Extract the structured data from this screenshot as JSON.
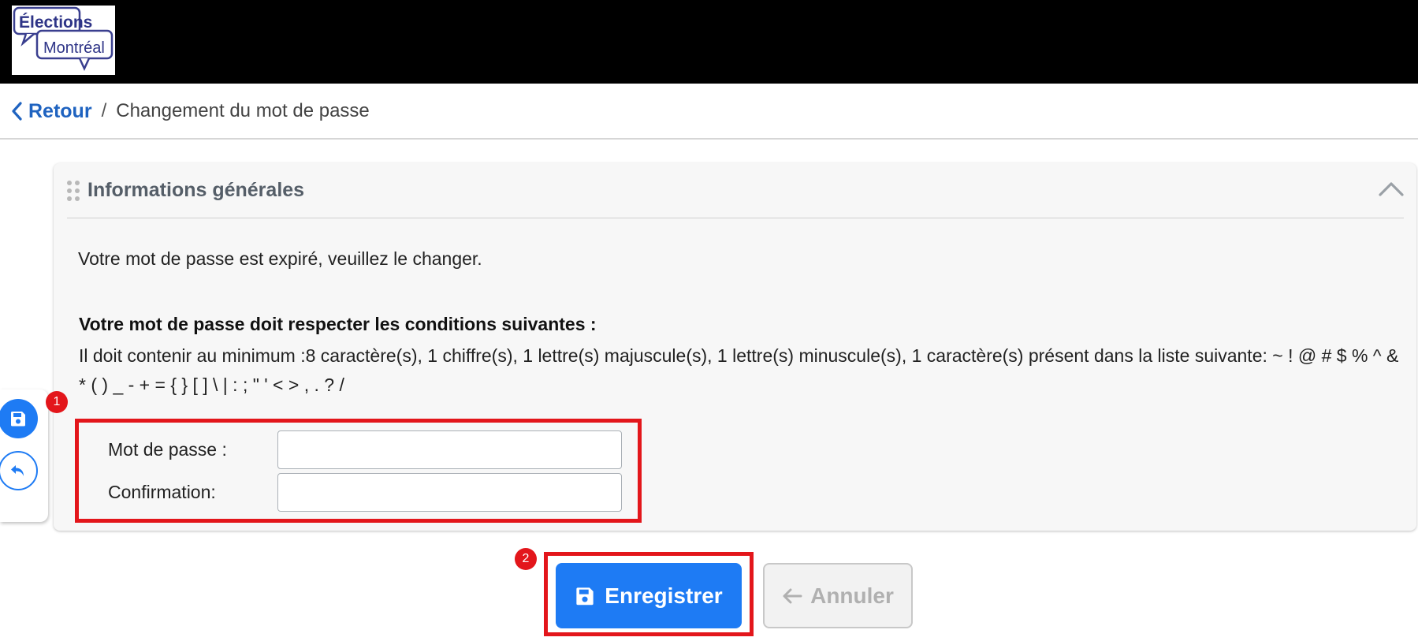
{
  "header": {
    "logo_line1": "Élections",
    "logo_line2": "Montréal"
  },
  "breadcrumb": {
    "back_label": "Retour",
    "separator": "/",
    "current": "Changement du mot de passe"
  },
  "side_tools": {
    "save_icon": "floppy-disk-icon",
    "undo_icon": "undo-arrow-icon"
  },
  "panel": {
    "title": "Informations générales",
    "expired_message": "Votre mot de passe est expiré, veuillez le changer.",
    "rules_title": "Votre mot de passe doit respecter les conditions suivantes :",
    "rules_text": "Il doit contenir au minimum :8 caractère(s), 1 chiffre(s), 1 lettre(s) majuscule(s), 1 lettre(s) minuscule(s), 1 caractère(s) présent dans la liste suivante: ~ ! @ # $ % ^ & * ( ) _ - + = { } [ ] \\ | : ; \" ' < > , . ? /",
    "password_label": "Mot de passe :",
    "password_value": "",
    "confirm_label": "Confirmation:",
    "confirm_value": ""
  },
  "annotations": {
    "badge1": "1",
    "badge2": "2"
  },
  "footer": {
    "save_label": "Enregistrer",
    "cancel_label": "Annuler"
  },
  "colors": {
    "primary": "#1e7bf4",
    "link": "#1f63c0",
    "highlight": "#e3161b",
    "header_bg": "#000000"
  }
}
